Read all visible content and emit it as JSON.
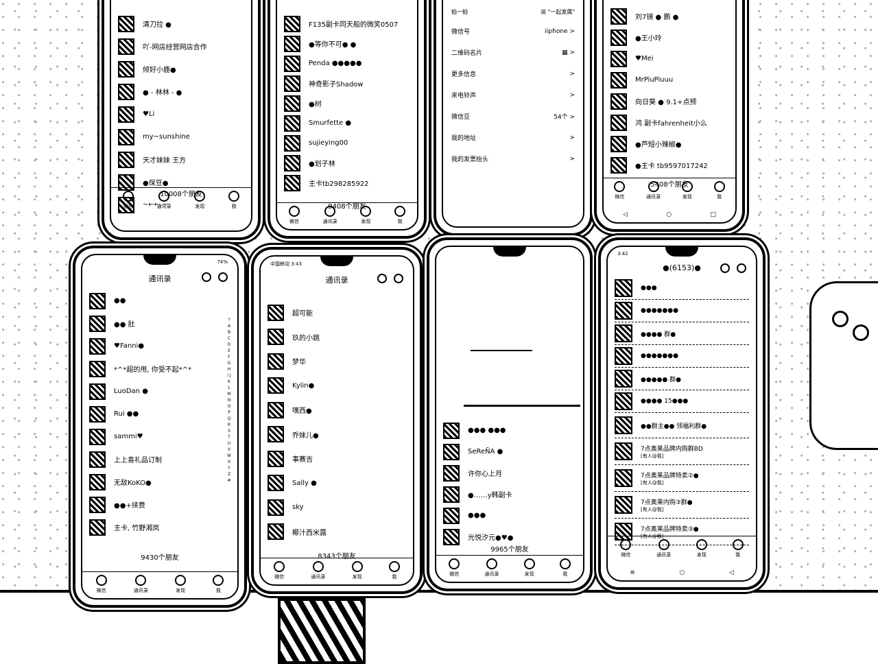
{
  "phones": {
    "p1": {
      "contacts": [
        "清刀拉 ●",
        "吖-网店经营网店合作",
        "倾好小鹿●",
        "● - 林林 - ●",
        "♥Li",
        "my~sunshine",
        "天才妹妹 王方",
        "●保豆●",
        "~←← ~"
      ],
      "count": "10008个朋友",
      "tabs": [
        "微信",
        "通讯录",
        "发现",
        "我"
      ]
    },
    "p2": {
      "contacts": [
        "F135副卡同天船的微笑0507",
        "●等你不可● ●",
        "Penda ●●●●●",
        "神奇影子Shadow",
        "●树",
        "Smurfette ●",
        "sujieying00",
        "●划子林",
        "主卡tb298285922"
      ],
      "count": "9408个朋友",
      "tabs": [
        "微信",
        "通讯录",
        "发现",
        "我"
      ]
    },
    "p3": {
      "top": "拍一拍",
      "top_right": "说 \"一起发属\"",
      "items": [
        {
          "label": "微信号",
          "value": "iiphone",
          "arrow": ">"
        },
        {
          "label": "二维码名片",
          "value": "",
          "arrow": ">"
        },
        {
          "label": "更多信息",
          "value": "",
          "arrow": ">"
        },
        {
          "label": "来电铃声",
          "value": "",
          "arrow": ">"
        },
        {
          "label": "微信豆",
          "value": "54个",
          "arrow": ">"
        },
        {
          "label": "我的地址",
          "value": "",
          "arrow": ">"
        },
        {
          "label": "我的发票抬头",
          "value": "",
          "arrow": ">"
        }
      ]
    },
    "p4": {
      "contacts": [
        "刘7镜 ● 鹏 ●",
        "●王小玲",
        "♥Mei",
        "MrPiuPiuuu",
        "向日葵 ● 9.1+点预",
        "鸿 副卡fahrenheit小么",
        "●芦短小辣椒●",
        "●主卡 tb9597017242"
      ],
      "count": "5408个朋友",
      "tabs": [
        "微信",
        "通讯录",
        "发现",
        "我"
      ],
      "nav": [
        "◁",
        "○",
        "□"
      ]
    },
    "p5": {
      "status_left": "",
      "status_right": "74%",
      "title": "通讯录",
      "contacts": [
        "●●",
        "●● 肚",
        "♥Fanni●",
        "*^*超的甩, 你受不起*^*",
        "LuoDan ●",
        "Rui ●●",
        "sammi♥",
        "上上喜礼品订制",
        "无敌KoKO●",
        "●●+续费",
        "主卡, 竹野湘岚"
      ],
      "count": "9430个朋友",
      "tabs": [
        "微信",
        "通讯录",
        "发现",
        "我"
      ]
    },
    "p6": {
      "status_left": "中国移动 3:43",
      "status_right": "",
      "title": "通讯录",
      "contacts": [
        "超可能",
        "玖的小跳",
        "梦华",
        "Kylin●",
        "嘿西●",
        "乔妹儿●",
        "事赛吉",
        "Sally ●",
        "sky",
        "椰汁西米露"
      ],
      "count": "8343个朋友",
      "tabs": [
        "微信",
        "通讯录",
        "发现",
        "我"
      ],
      "index": "↑ A B C D E F G H I J K L M N O P Q R S T U V W X Y Z #"
    },
    "p7": {
      "contacts": [
        "●●● ●●●",
        "SeReÑA ●",
        "许你心上月",
        "●……y韩副卡",
        "●●●",
        "光悦汐元●♥●"
      ],
      "count": "9965个朋友",
      "tabs": [
        "微信",
        "通讯录",
        "发现",
        "我"
      ]
    },
    "p8": {
      "status_left": "3:42",
      "title": "●(6153)●",
      "chats": [
        {
          "name": "●●●",
          "msg": ""
        },
        {
          "name": "●●●●●●●",
          "msg": ""
        },
        {
          "name": "●●●● 群●",
          "msg": ""
        },
        {
          "name": "●●●●●●●",
          "msg": ""
        },
        {
          "name": "●●●●● 群●",
          "msg": ""
        },
        {
          "name": "●●●● 15●●●",
          "msg": ""
        },
        {
          "name": "●●群主●● 领福利群●",
          "msg": ""
        },
        {
          "name": "7点奥莱品牌内购群BD",
          "msg": "[有人@我]"
        },
        {
          "name": "7点奥莱品牌特卖②●",
          "msg": "[有人@我]"
        },
        {
          "name": "7点奥莱内购③群●",
          "msg": "[有人@我]"
        },
        {
          "name": "7点奥莱品牌特卖③●",
          "msg": "[有人@我]"
        }
      ],
      "tabs": [
        "微信",
        "通讯录",
        "发现",
        "我"
      ],
      "nav": [
        "≡",
        "○",
        "◁"
      ]
    }
  }
}
